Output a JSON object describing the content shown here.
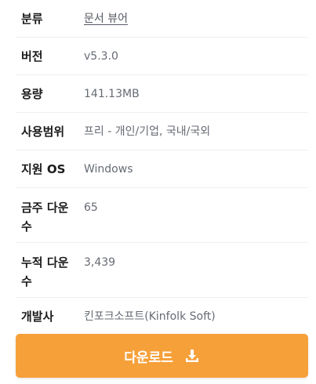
{
  "info": [
    {
      "label": "분류",
      "value": "문서 뷰어",
      "link": true
    },
    {
      "label": "버전",
      "value": "v5.3.0"
    },
    {
      "label": "용량",
      "value": "141.13MB"
    },
    {
      "label": "사용범위",
      "value": "프리 - 개인/기업, 국내/국외"
    },
    {
      "label": "지원 OS",
      "value": "Windows"
    },
    {
      "label": "금주 다운\n수",
      "value": "65"
    },
    {
      "label": "누적 다운\n수",
      "value": "3,439"
    },
    {
      "label": "개발사",
      "value": "킨포크소프트(Kinfolk Soft)"
    }
  ],
  "download": {
    "label": "다운로드",
    "icon": "download-icon",
    "color": "#f6a03a"
  }
}
